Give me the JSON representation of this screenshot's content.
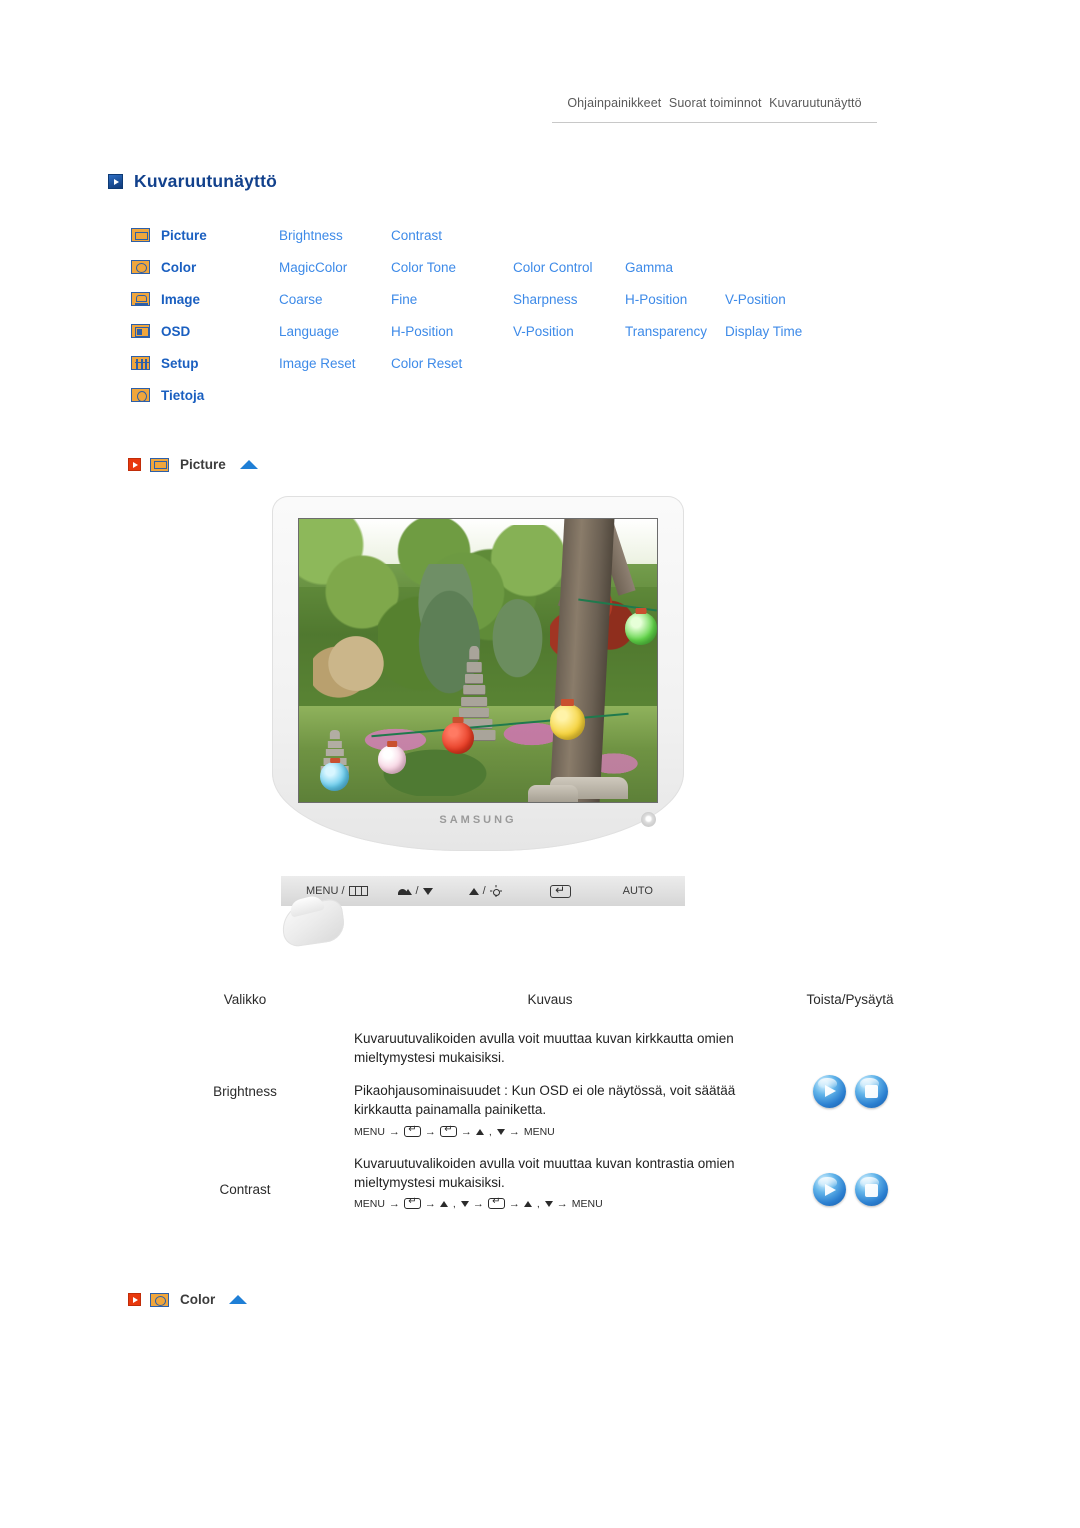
{
  "breadcrumb": {
    "items": [
      "Ohjainpainikkeet",
      "Suorat toiminnot",
      "Kuvaruutunäyttö"
    ]
  },
  "page_title": "Kuvaruutunäyttö",
  "accent_colors": {
    "title_blue": "#12418c",
    "category_blue": "#1a5fc0",
    "item_blue": "#3d8ae8",
    "red_marker": "#e8380d",
    "icon_gold": "#f0a63c",
    "icon_border": "#2d5fa8",
    "orb_blue": "#2b7fd0"
  },
  "menu_map": {
    "rows": [
      {
        "icon": "picture-icon",
        "category": "Picture",
        "items": [
          "Brightness",
          "Contrast"
        ]
      },
      {
        "icon": "color-icon",
        "category": "Color",
        "items": [
          "MagicColor",
          "Color Tone",
          "Color Control",
          "Gamma"
        ]
      },
      {
        "icon": "image-icon",
        "category": "Image",
        "items": [
          "Coarse",
          "Fine",
          "Sharpness",
          "H-Position",
          "V-Position"
        ]
      },
      {
        "icon": "osd-icon",
        "category": "OSD",
        "items": [
          "Language",
          "H-Position",
          "V-Position",
          "Transparency",
          "Display Time"
        ]
      },
      {
        "icon": "setup-icon",
        "category": "Setup",
        "items": [
          "Image Reset",
          "Color Reset"
        ]
      },
      {
        "icon": "info-icon",
        "category": "Tietoja",
        "items": []
      }
    ]
  },
  "sections": [
    {
      "label": "Picture",
      "icon": "picture-icon"
    },
    {
      "label": "Color",
      "icon": "color-icon"
    }
  ],
  "monitor": {
    "brand": "SAMSUNG",
    "controls": [
      {
        "label": "MENU /",
        "glyph": "osd-panel-icon"
      },
      {
        "label": "/",
        "glyph": "magicbright-down-icon"
      },
      {
        "label": "/",
        "glyph": "up-brightness-icon"
      },
      {
        "label": "",
        "glyph": "enter-icon"
      },
      {
        "label": "AUTO",
        "glyph": ""
      }
    ],
    "screen_scene": "Korean temple garden with stone pagodas, azaleas and colored paper lanterns"
  },
  "desc_table": {
    "headers": {
      "menu": "Valikko",
      "description": "Kuvaus",
      "playstop": "Toista/Pysäytä"
    },
    "rows": [
      {
        "menu": "Brightness",
        "paragraphs": [
          "Kuvaruutuvalikoiden avulla voit muuttaa kuvan kirkkautta omien mieltymystesi mukaisiksi.",
          "Pikaohjausominaisuudet : Kun OSD ei ole näytössä, voit säätää kirkkautta painamalla painiketta."
        ],
        "nav": [
          "MENU",
          "→",
          "ENTER",
          "→",
          "ENTER",
          "→",
          "UP",
          ",",
          "DOWN",
          "→",
          "MENU"
        ],
        "buttons": [
          "play-button",
          "stop-button"
        ]
      },
      {
        "menu": "Contrast",
        "paragraphs": [
          "Kuvaruutuvalikoiden avulla voit muuttaa kuvan kontrastia omien mieltymystesi mukaisiksi."
        ],
        "nav": [
          "MENU",
          "→",
          "ENTER",
          "→",
          "UP",
          ",",
          "DOWN",
          "→",
          "ENTER",
          "→",
          "UP",
          ",",
          "DOWN",
          "→",
          "MENU"
        ],
        "buttons": [
          "play-button",
          "stop-button"
        ]
      }
    ]
  }
}
